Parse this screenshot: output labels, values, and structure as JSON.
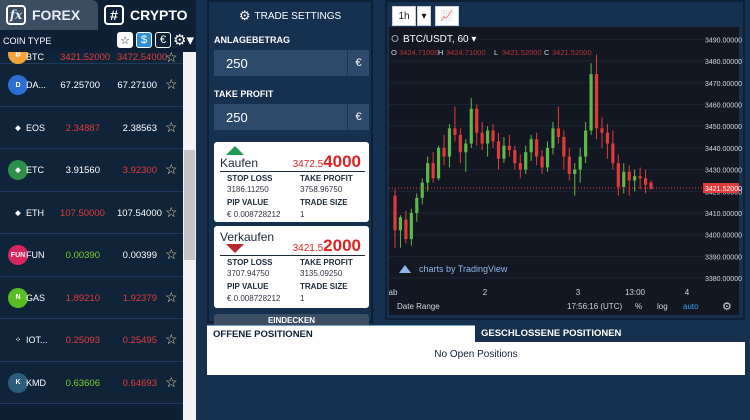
{
  "tabs": {
    "forex": {
      "icon": "fx",
      "label": "FOREX"
    },
    "crypto": {
      "icon": "#",
      "label": "CRYPTO"
    }
  },
  "list_header": {
    "label": "COIN TYPE",
    "star": "☆",
    "dollar": "$",
    "euro": "€"
  },
  "coins": [
    {
      "name": "BTC",
      "bid": "3421.52000",
      "ask": "3472.54000",
      "bid_color": "red",
      "ask_color": "red",
      "icon_color": "#f2a33a",
      "icon_text": "₿"
    },
    {
      "name": "DA...",
      "bid": "67.25700",
      "ask": "67.27100",
      "bid_color": "white",
      "ask_color": "white",
      "icon_color": "#2b6fd3",
      "icon_text": "D"
    },
    {
      "name": "EOS",
      "bid": "2.34887",
      "ask": "2.38563",
      "bid_color": "red",
      "ask_color": "white",
      "icon_color": "#0f2439",
      "icon_text": "◆"
    },
    {
      "name": "ETC",
      "bid": "3.91560",
      "ask": "3.92300",
      "bid_color": "white",
      "ask_color": "red",
      "icon_color": "#2e8f4a",
      "icon_text": "◆"
    },
    {
      "name": "ETH",
      "bid": "107.50000",
      "ask": "107.54000",
      "bid_color": "red",
      "ask_color": "white",
      "icon_color": "#0f2439",
      "icon_text": "◆"
    },
    {
      "name": "FUN",
      "bid": "0.00390",
      "ask": "0.00399",
      "bid_color": "green",
      "ask_color": "white",
      "icon_color": "#d9255f",
      "icon_text": "FUN"
    },
    {
      "name": "GAS",
      "bid": "1.89210",
      "ask": "1.92379",
      "bid_color": "red",
      "ask_color": "red",
      "icon_color": "#58be23",
      "icon_text": "N"
    },
    {
      "name": "IOT...",
      "bid": "0.25093",
      "ask": "0.25495",
      "bid_color": "red",
      "ask_color": "red",
      "icon_color": "#0f2439",
      "icon_text": "⁘"
    },
    {
      "name": "KMD",
      "bid": "0.63606",
      "ask": "0.64693",
      "bid_color": "green",
      "ask_color": "red",
      "icon_color": "#2c5d7a",
      "icon_text": "K"
    }
  ],
  "trade": {
    "title": "TRADE SETTINGS",
    "amount_label": "ANLAGEBETRAG",
    "amount_value": "250",
    "take_profit_label": "TAKE PROFIT",
    "take_profit_value": "250",
    "currency": "€",
    "buy": {
      "action": "Kaufen",
      "price_main": "3472.5",
      "price_big": "4000",
      "stop_loss_label": "STOP LOSS",
      "stop_loss": "3186.11250",
      "take_profit_label": "TAKE PROFIT",
      "take_profit": "3758.96750",
      "pip_label": "PIP VALUE",
      "pip_value": "€ 0.008728212",
      "size_label": "TRADE SIZE",
      "size": "1"
    },
    "sell": {
      "action": "Verkaufen",
      "price_main": "3421.5",
      "price_big": "2000",
      "stop_loss_label": "STOP LOSS",
      "stop_loss": "3707.94750",
      "take_profit_label": "TAKE PROFIT",
      "take_profit": "3135.09250",
      "pip_label": "PIP VALUE",
      "pip_value": "€ 0.008728212",
      "size_label": "TRADE SIZE",
      "size": "1"
    },
    "undo_label": "EINDECKEN"
  },
  "chart_toolbar": {
    "interval": "1h"
  },
  "chart_data": {
    "type": "candlestick",
    "symbol": "BTC/USDT, 60",
    "ohlc_labels": {
      "o": "O",
      "o_val": "3424.71000",
      "h": "H",
      "h_val": "3424.71000",
      "l": "L",
      "l_val": "3421.52000",
      "c": "C",
      "c_val": "3421.52000"
    },
    "yticks": [
      "3490.00000",
      "3480.00000",
      "3470.00000",
      "3460.00000",
      "3450.00000",
      "3440.00000",
      "3430.00000",
      "3420.00000",
      "3410.00000",
      "3400.00000",
      "3390.00000",
      "3380.00000"
    ],
    "ylim": [
      3375,
      3492
    ],
    "xticks": [
      "ab",
      "2",
      "3",
      "13:00",
      "4"
    ],
    "last_price": "3421.52000",
    "last_price_value": 3421.52,
    "watermark": "charts by TradingView",
    "candles": [
      [
        3418,
        3421,
        3394,
        3402
      ],
      [
        3402,
        3409,
        3394,
        3408
      ],
      [
        3407,
        3411,
        3396,
        3398
      ],
      [
        3398,
        3412,
        3395,
        3410
      ],
      [
        3410,
        3419,
        3406,
        3417
      ],
      [
        3417,
        3426,
        3414,
        3424
      ],
      [
        3424,
        3436,
        3420,
        3433
      ],
      [
        3433,
        3438,
        3424,
        3426
      ],
      [
        3426,
        3441,
        3425,
        3440
      ],
      [
        3440,
        3446,
        3432,
        3436
      ],
      [
        3436,
        3451,
        3431,
        3449
      ],
      [
        3449,
        3459,
        3443,
        3446
      ],
      [
        3446,
        3449,
        3433,
        3438
      ],
      [
        3438,
        3444,
        3429,
        3442
      ],
      [
        3442,
        3463,
        3440,
        3458
      ],
      [
        3458,
        3460,
        3441,
        3447
      ],
      [
        3447,
        3452,
        3439,
        3442
      ],
      [
        3442,
        3450,
        3436,
        3448
      ],
      [
        3448,
        3451,
        3440,
        3443
      ],
      [
        3443,
        3447,
        3430,
        3435
      ],
      [
        3435,
        3445,
        3433,
        3441
      ],
      [
        3441,
        3446,
        3436,
        3439
      ],
      [
        3439,
        3441,
        3430,
        3433
      ],
      [
        3433,
        3437,
        3426,
        3430
      ],
      [
        3430,
        3441,
        3428,
        3438
      ],
      [
        3438,
        3446,
        3434,
        3444
      ],
      [
        3444,
        3447,
        3432,
        3436
      ],
      [
        3436,
        3439,
        3428,
        3431
      ],
      [
        3431,
        3443,
        3429,
        3440
      ],
      [
        3440,
        3452,
        3437,
        3449
      ],
      [
        3449,
        3459,
        3442,
        3445
      ],
      [
        3445,
        3448,
        3430,
        3436
      ],
      [
        3436,
        3440,
        3425,
        3428
      ],
      [
        3428,
        3433,
        3418,
        3430
      ],
      [
        3430,
        3440,
        3424,
        3436
      ],
      [
        3436,
        3452,
        3433,
        3448
      ],
      [
        3448,
        3479,
        3446,
        3474
      ],
      [
        3474,
        3483,
        3444,
        3449
      ],
      [
        3449,
        3454,
        3440,
        3447
      ],
      [
        3447,
        3451,
        3435,
        3442
      ],
      [
        3442,
        3448,
        3430,
        3433
      ],
      [
        3433,
        3437,
        3418,
        3422
      ],
      [
        3422,
        3433,
        3419,
        3429
      ],
      [
        3429,
        3432,
        3418,
        3425
      ],
      [
        3425,
        3430,
        3420,
        3427
      ],
      [
        3427,
        3431,
        3421,
        3426
      ],
      [
        3426,
        3430,
        3419,
        3423
      ],
      [
        3424,
        3425,
        3421,
        3421
      ]
    ]
  },
  "chart_bottom": {
    "date_range": "Date Range",
    "time": "17:56:16 (UTC)",
    "percent": "%",
    "log": "log",
    "auto": "auto"
  },
  "positions": {
    "open_tab": "OFFENE POSITIONEN",
    "closed_tab": "GESCHLOSSENE POSITIONEN",
    "empty": "No Open Positions"
  },
  "colors": {
    "up": "#5fb84a",
    "down": "#e03a3a",
    "chart_bg": "#131722",
    "grid": "#1c2433"
  }
}
